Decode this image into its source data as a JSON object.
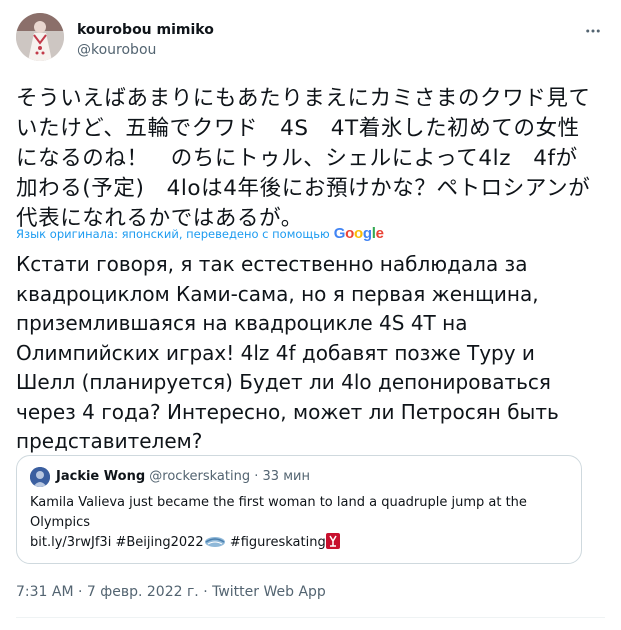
{
  "author": {
    "display_name": "kourobou mimiko",
    "handle": "@kourobou"
  },
  "tweet": {
    "original_text": "そういえばあまりにもあたりまえにカミさまのクワド見ていたけど、五輪でクワド　4S　4T着氷した初めての女性になるのね！　のちにトゥル、シェルによって4lz　4fが加わる(予定)　4loは4年後にお預けかな？ペトロシアンが代表になれるかではあるが。",
    "translation_note": "Язык оригинала: японский, переведено с помощью",
    "translation_provider": "Google",
    "translated_text": "Кстати говоря, я так естественно наблюдала за квадроциклом Ками-сама, но я первая женщина, приземлившаяся на квадроцикле 4S 4T на Олимпийских играх! 4lz 4f добавят позже Туру и Шелл (планируется) Будет ли 4lo депонироваться через 4 года? Интересно, может ли Петросян быть представителем?",
    "timestamp": "7:31 AM · 7 февр. 2022 г. · Twitter Web App"
  },
  "quoted_tweet": {
    "name": "Jackie Wong",
    "handle": "@rockerskating",
    "separator": "·",
    "time": "33 мин",
    "text": "Kamila Valieva just became the first woman to land a quadruple jump at the Olympics",
    "link": "bit.ly/3rwJf3i",
    "hashtag_1": "#Beijing2022",
    "hashtag_2": "#figureskating"
  },
  "icons": {
    "more": "more-horizontal-icon",
    "quoted_emoji_1": "beijing-2022-emoji-icon",
    "quoted_emoji_2": "figure-skating-emoji-icon"
  },
  "colors": {
    "link_blue": "#1d9bf0",
    "secondary_text": "#536471",
    "border": "#cfd9de",
    "google_blue": "#4285F4",
    "google_red": "#EA4335",
    "google_yellow": "#FBBC05",
    "google_green": "#34A853"
  }
}
